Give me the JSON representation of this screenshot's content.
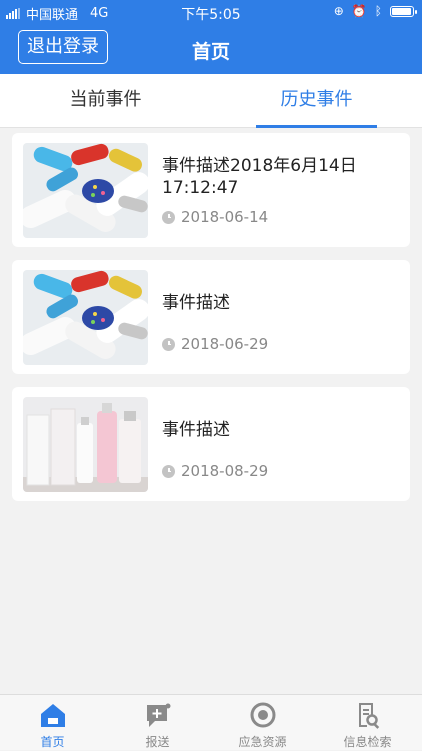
{
  "status_bar": {
    "carrier": "中国联通",
    "network": "4G",
    "time": "下午5:05"
  },
  "nav": {
    "logout_label": "退出登录",
    "title": "首页"
  },
  "tabs": [
    {
      "label": "当前事件",
      "active": false
    },
    {
      "label": "历史事件",
      "active": true
    }
  ],
  "events": [
    {
      "title": "事件描述2018年6月14日17:12:47",
      "date": "2018-06-14",
      "image": "pills"
    },
    {
      "title": "事件描述",
      "date": "2018-06-29",
      "image": "pills"
    },
    {
      "title": "事件描述",
      "date": "2018-08-29",
      "image": "cosmetics"
    }
  ],
  "tabbar": [
    {
      "label": "首页",
      "icon": "home-icon",
      "active": true
    },
    {
      "label": "报送",
      "icon": "report-icon",
      "active": false
    },
    {
      "label": "应急资源",
      "icon": "resource-icon",
      "active": false
    },
    {
      "label": "信息检索",
      "icon": "search-doc-icon",
      "active": false
    }
  ],
  "colors": {
    "primary": "#2f7ee6",
    "background": "#f2f2f2",
    "inactive_icon": "#8a8a8a"
  }
}
